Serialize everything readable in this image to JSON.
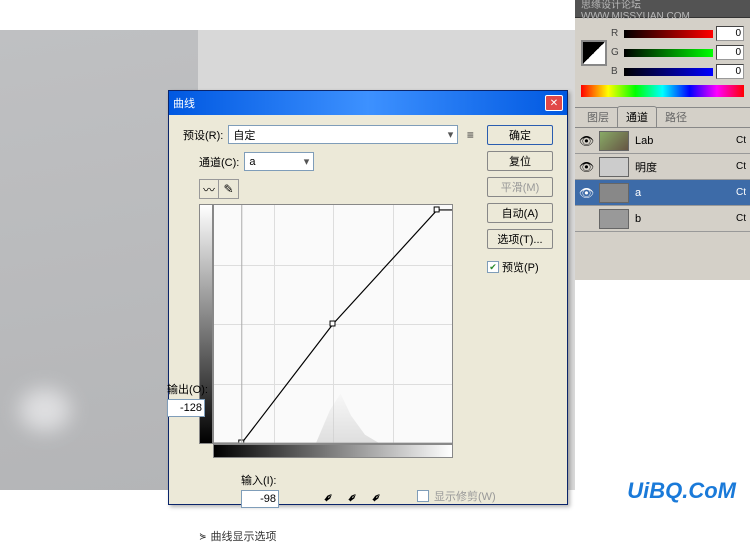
{
  "dialog": {
    "title": "曲线",
    "preset_label": "预设(R):",
    "preset_value": "自定",
    "channel_label": "通道(C):",
    "channel_value": "a",
    "output_label": "输出(O):",
    "output_value": "-128",
    "input_label": "输入(I):",
    "input_value": "-98",
    "show_clip": "显示修剪(W)",
    "expand": "曲线显示选项"
  },
  "buttons": {
    "ok": "确定",
    "reset": "复位",
    "smooth": "平滑(M)",
    "auto": "自动(A)",
    "options": "选项(T)...",
    "preview": "预览(P)"
  },
  "panels": {
    "top_text": "思缘设计论坛   WWW.MISSYUAN.COM",
    "rgb": {
      "r": "R",
      "g": "G",
      "b": "B",
      "val": "0"
    },
    "tabs": {
      "layers": "图层",
      "channels": "通道",
      "paths": "路径"
    },
    "channels": [
      {
        "name": "Lab",
        "short": "Ct"
      },
      {
        "name": "明度",
        "short": "Ct"
      },
      {
        "name": "a",
        "short": "Ct"
      },
      {
        "name": "b",
        "short": "Ct"
      }
    ]
  },
  "watermark": "UiBQ.CoM",
  "chart_data": {
    "type": "line",
    "title": "曲线",
    "xlabel": "输入",
    "ylabel": "输出",
    "x_range": [
      -128,
      127
    ],
    "y_range": [
      -128,
      127
    ],
    "points": [
      {
        "x": -128,
        "y": -128
      },
      {
        "x": -98,
        "y": -128
      },
      {
        "x": 0,
        "y": 0
      },
      {
        "x": 110,
        "y": 127
      },
      {
        "x": 127,
        "y": 127
      }
    ],
    "selected_point": {
      "x": -98,
      "y": -128
    }
  }
}
